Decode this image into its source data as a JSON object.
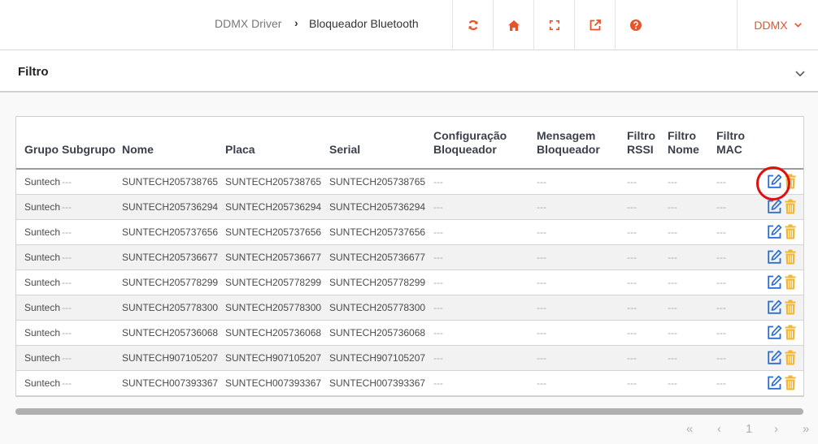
{
  "breadcrumb": {
    "parent": "DDMX Driver",
    "separator": "›",
    "current": "Bloqueador Bluetooth"
  },
  "toolbar": {
    "icons": [
      "refresh-icon",
      "home-icon",
      "fullscreen-icon",
      "external-link-icon",
      "help-icon"
    ],
    "accent_color": "#e8542a",
    "user_label": "DDMX",
    "user_chevron": "⌄"
  },
  "filter": {
    "title": "Filtro"
  },
  "table": {
    "headers": {
      "grupo": "Grupo",
      "subgrupo": "Subgrupo",
      "nome": "Nome",
      "placa": "Placa",
      "serial": "Serial",
      "config_line1": "Configuração",
      "config_line2": "Bloqueador",
      "msg_line1": "Mensagem",
      "msg_line2": "Bloqueador",
      "rssi_line1": "Filtro",
      "rssi_line2": "RSSI",
      "fnome_line1": "Filtro",
      "fnome_line2": "Nome",
      "mac_line1": "Filtro",
      "mac_line2": "MAC"
    },
    "rows": [
      {
        "grupo": "Suntech",
        "subgrupo": "---",
        "nome": "SUNTECH205738765",
        "placa": "SUNTECH205738765",
        "serial": "SUNTECH205738765",
        "config": "---",
        "mensagem": "---",
        "rssi": "---",
        "fnome": "---",
        "mac": "---"
      },
      {
        "grupo": "Suntech",
        "subgrupo": "---",
        "nome": "SUNTECH205736294",
        "placa": "SUNTECH205736294",
        "serial": "SUNTECH205736294",
        "config": "---",
        "mensagem": "---",
        "rssi": "---",
        "fnome": "---",
        "mac": "---"
      },
      {
        "grupo": "Suntech",
        "subgrupo": "---",
        "nome": "SUNTECH205737656",
        "placa": "SUNTECH205737656",
        "serial": "SUNTECH205737656",
        "config": "---",
        "mensagem": "---",
        "rssi": "---",
        "fnome": "---",
        "mac": "---"
      },
      {
        "grupo": "Suntech",
        "subgrupo": "---",
        "nome": "SUNTECH205736677",
        "placa": "SUNTECH205736677",
        "serial": "SUNTECH205736677",
        "config": "---",
        "mensagem": "---",
        "rssi": "---",
        "fnome": "---",
        "mac": "---"
      },
      {
        "grupo": "Suntech",
        "subgrupo": "---",
        "nome": "SUNTECH205778299",
        "placa": "SUNTECH205778299",
        "serial": "SUNTECH205778299",
        "config": "---",
        "mensagem": "---",
        "rssi": "---",
        "fnome": "---",
        "mac": "---"
      },
      {
        "grupo": "Suntech",
        "subgrupo": "---",
        "nome": "SUNTECH205778300",
        "placa": "SUNTECH205778300",
        "serial": "SUNTECH205778300",
        "config": "---",
        "mensagem": "---",
        "rssi": "---",
        "fnome": "---",
        "mac": "---"
      },
      {
        "grupo": "Suntech",
        "subgrupo": "---",
        "nome": "SUNTECH205736068",
        "placa": "SUNTECH205736068",
        "serial": "SUNTECH205736068",
        "config": "---",
        "mensagem": "---",
        "rssi": "---",
        "fnome": "---",
        "mac": "---"
      },
      {
        "grupo": "Suntech",
        "subgrupo": "---",
        "nome": "SUNTECH907105207",
        "placa": "SUNTECH907105207",
        "serial": "SUNTECH907105207",
        "config": "---",
        "mensagem": "---",
        "rssi": "---",
        "fnome": "---",
        "mac": "---"
      },
      {
        "grupo": "Suntech",
        "subgrupo": "---",
        "nome": "SUNTECH007393367",
        "placa": "SUNTECH007393367",
        "serial": "SUNTECH007393367",
        "config": "---",
        "mensagem": "---",
        "rssi": "---",
        "fnome": "---",
        "mac": "---"
      }
    ],
    "edit_icon_color": "#2a6fcf",
    "trash_icon_color": "#f2b632",
    "highlight_color": "#e01010"
  },
  "pager": {
    "first": "«",
    "prev": "‹",
    "page": "1",
    "next": "›",
    "last": "»"
  }
}
